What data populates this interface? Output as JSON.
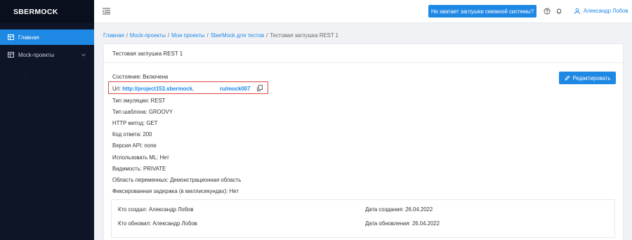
{
  "app": {
    "logo": "SBERMOCK"
  },
  "sidebar": {
    "items": [
      {
        "label": "Главная",
        "icon": "home-icon",
        "active": true
      },
      {
        "label": "Mock-проекты",
        "icon": "folder-icon",
        "active": false
      }
    ]
  },
  "topbar": {
    "alert_button": "Не хватает заглушки смежной системы?",
    "user": "Александр Лобов"
  },
  "breadcrumb": {
    "items": [
      "Главная",
      "Mock-проекты",
      "Мои проекты",
      "SberMock для тестов"
    ],
    "current": "Тестовая заглушка REST 1"
  },
  "card": {
    "title": "Тестовая заглушка REST 1",
    "edit_label": "Редактировать",
    "url": {
      "label": "Url: ",
      "part1": "http://project153.sbermock.",
      "part2": "ru/mock007"
    },
    "fields": [
      {
        "label": "Состояние:",
        "value": "Включена"
      },
      {
        "label": "Тип эмуляции:",
        "value": "REST"
      },
      {
        "label": "Тип шаблона:",
        "value": "GROOVY"
      },
      {
        "label": "HTTP метод:",
        "value": "GET"
      },
      {
        "label": "Код ответа:",
        "value": "200"
      },
      {
        "label": "Версия API:",
        "value": "none"
      },
      {
        "label": "Использовать ML:",
        "value": "Нет"
      },
      {
        "label": "Видимость:",
        "value": "PRIVATE"
      },
      {
        "label": "Область переменных:",
        "value": "Демонстрационная область"
      },
      {
        "label": "Фиксированная задержка (в миллисекундах):",
        "value": "Нет"
      }
    ],
    "meta": {
      "created_by_label": "Кто создал:",
      "created_by": "Александр Лобов",
      "updated_by_label": "Кто обновил:",
      "updated_by": "Александр Лобов",
      "created_date_label": "Дата создания:",
      "created_date": "26.04.2022",
      "updated_date_label": "Дата обновления:",
      "updated_date": "26.04.2022"
    }
  },
  "colors": {
    "accent": "#1e88e5",
    "sidebar": "#0e1526",
    "highlight": "#e04848"
  }
}
